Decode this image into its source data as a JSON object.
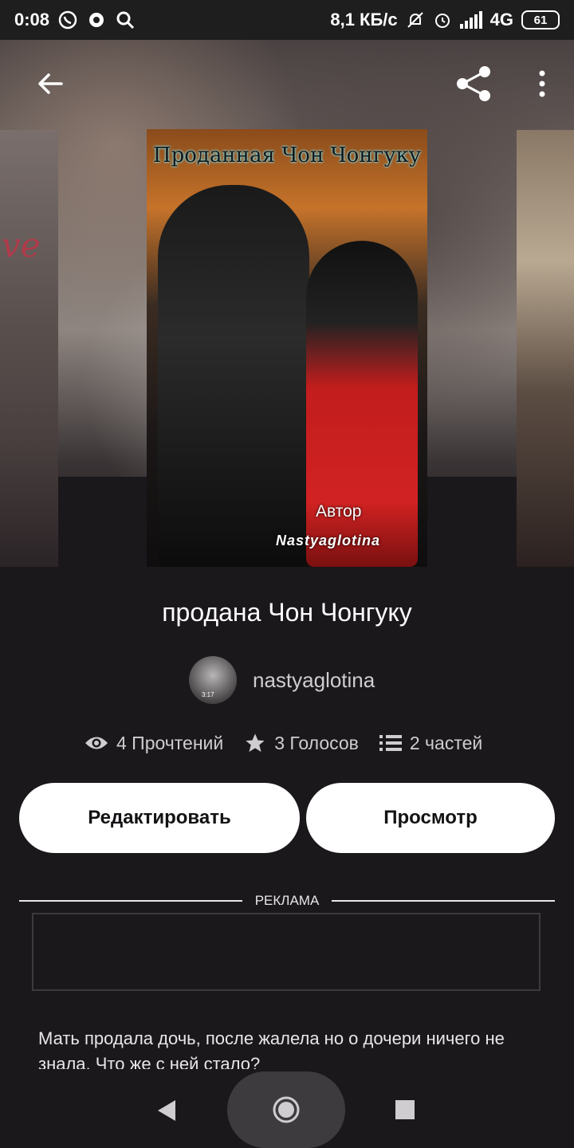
{
  "status_bar": {
    "time": "0:08",
    "network_speed": "8,1 КБ/с",
    "network_type": "4G",
    "battery": "61"
  },
  "book": {
    "title": "продана Чон Чонгуку",
    "author": "nastyaglotina",
    "cover": {
      "title": "Проданная Чон Чонгуку",
      "author_label": "Автор",
      "author_name": "Nastyaglotina"
    },
    "left_cover_text": "ve",
    "avatar_time": "3:17"
  },
  "stats": {
    "reads": "4 Прочтений",
    "votes": "3 Голосов",
    "parts": "2 частей"
  },
  "buttons": {
    "edit": "Редактировать",
    "view": "Просмотр"
  },
  "ad": {
    "label": "РЕКЛАМА"
  },
  "description": "Мать продала дочь, после жалела но о дочери ничего не знала. Что же с ней стало?",
  "icons": {
    "back": "back-arrow-icon",
    "share": "share-icon",
    "more": "more-vert-icon",
    "eye": "eye-icon",
    "star": "star-icon",
    "list": "list-icon"
  },
  "colors": {
    "background": "#1b181c",
    "button_bg": "#ffffff",
    "text_secondary": "#cfcdcf"
  }
}
